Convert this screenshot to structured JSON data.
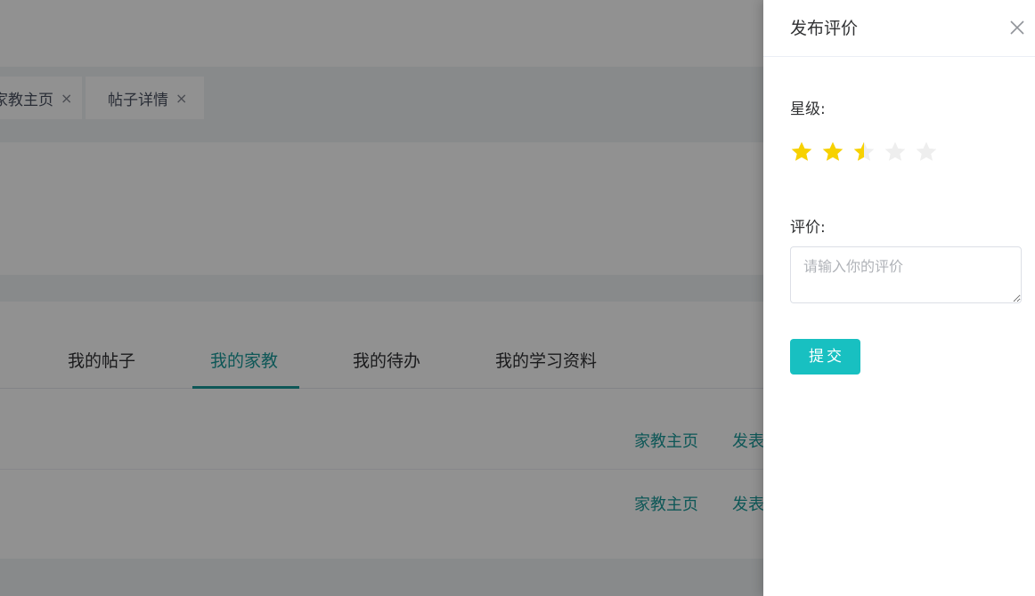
{
  "tags": [
    {
      "label": "家教主页",
      "close": "×"
    },
    {
      "label": "帖子详情",
      "close": "×"
    }
  ],
  "tabs": [
    {
      "label": "我的帖子",
      "active": false
    },
    {
      "label": "我的家教",
      "active": true
    },
    {
      "label": "我的待办",
      "active": false
    },
    {
      "label": "我的学习资料",
      "active": false
    }
  ],
  "rows": [
    {
      "link_home": "家教主页",
      "link_publish": "发表"
    },
    {
      "link_home": "家教主页",
      "link_publish": "发表"
    }
  ],
  "drawer": {
    "title": "发布评价",
    "close_icon": "close-icon",
    "rating_label": "星级:",
    "rating_value": 2.5,
    "rating_max": 5,
    "comment_label": "评价:",
    "comment_placeholder": "请输入你的评价",
    "comment_value": "",
    "submit_label": "提交"
  },
  "colors": {
    "accent": "#18c0c1",
    "tab_active": "#1a9a9a",
    "star_on": "#f7d100",
    "star_off": "#eeeeee"
  }
}
